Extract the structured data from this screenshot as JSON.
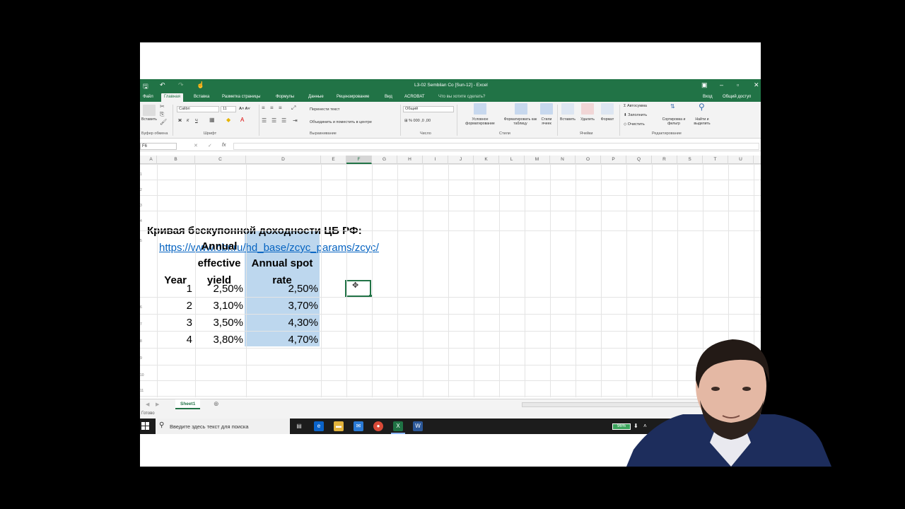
{
  "window": {
    "title": "L3-02 Sembilan Co [Sun-12] - Excel",
    "login": "Вход",
    "share": "Общий доступ"
  },
  "tabs": [
    {
      "label": "Файл"
    },
    {
      "label": "Главная",
      "active": true
    },
    {
      "label": "Вставка"
    },
    {
      "label": "Разметка страницы"
    },
    {
      "label": "Формулы"
    },
    {
      "label": "Данные"
    },
    {
      "label": "Рецензирование"
    },
    {
      "label": "Вид"
    },
    {
      "label": "ACROBAT"
    }
  ],
  "tell_me": "Что вы хотите сделать?",
  "ribbon": {
    "clipboard": {
      "paste": "Вставить",
      "label": "Буфер обмена"
    },
    "font": {
      "name": "Calibri",
      "size": "11",
      "label": "Шрифт"
    },
    "alignment": {
      "wrap": "Перенести текст",
      "merge": "Объединить и поместить в центре",
      "label": "Выравнивание"
    },
    "number": {
      "format": "Общий",
      "label": "Число"
    },
    "styles": {
      "conditional": "Условное форматирование",
      "as_table": "Форматировать как таблицу",
      "cell_styles": "Стили ячеек",
      "label": "Стили"
    },
    "cells": {
      "insert": "Вставить",
      "delete": "Удалить",
      "format": "Формат",
      "label": "Ячейки"
    },
    "editing": {
      "autosum": "Автосумма",
      "fill": "Заполнить",
      "clear": "Очистить",
      "sort": "Сортировка и фильтр",
      "find": "Найти и выделить",
      "label": "Редактирование"
    }
  },
  "formula_bar": {
    "name_box": "F6",
    "value": ""
  },
  "columns": [
    "A",
    "B",
    "C",
    "D",
    "E",
    "F",
    "G",
    "H",
    "I",
    "J",
    "K",
    "L",
    "M",
    "N",
    "O",
    "P",
    "Q",
    "R",
    "S",
    "T",
    "U"
  ],
  "selected_column": "F",
  "row_numbers": [
    "1",
    "2",
    "3",
    "4",
    "5",
    "6",
    "7",
    "8",
    "9",
    "10",
    "11",
    "12"
  ],
  "sheet": {
    "caption": "Кривая бескупонной доходности ЦБ РФ:",
    "link": "https://www.cbr.ru/hd_base/zcyc_params/zcyc/",
    "headers": {
      "year": "Year",
      "yield_line1": "Annual",
      "yield_line2": "effective",
      "yield_line3": "yield",
      "spot_line1": "Annual spot",
      "spot_line2": "rate"
    },
    "rows": [
      {
        "year": "1",
        "yield": "2,50%",
        "spot": "2,50%"
      },
      {
        "year": "2",
        "yield": "3,10%",
        "spot": "3,70%"
      },
      {
        "year": "3",
        "yield": "3,50%",
        "spot": "4,30%"
      },
      {
        "year": "4",
        "yield": "3,80%",
        "spot": "4,70%"
      }
    ]
  },
  "sheet_tabs": [
    {
      "label": "Sheet1",
      "active": true
    }
  ],
  "status": "Готово",
  "taskbar": {
    "search_placeholder": "Введите здесь текст для поиска",
    "battery": "96%"
  },
  "colors": {
    "excel_green": "#217346",
    "highlight_blue": "#bdd7ee",
    "link_blue": "#0563c1"
  },
  "icons": [
    "save-icon",
    "undo-icon",
    "redo-icon",
    "touch-icon",
    "search-icon",
    "windows-start-icon",
    "task-view-icon",
    "edge-icon",
    "file-explorer-icon",
    "mail-icon",
    "chrome-icon",
    "excel-icon",
    "word-icon"
  ]
}
